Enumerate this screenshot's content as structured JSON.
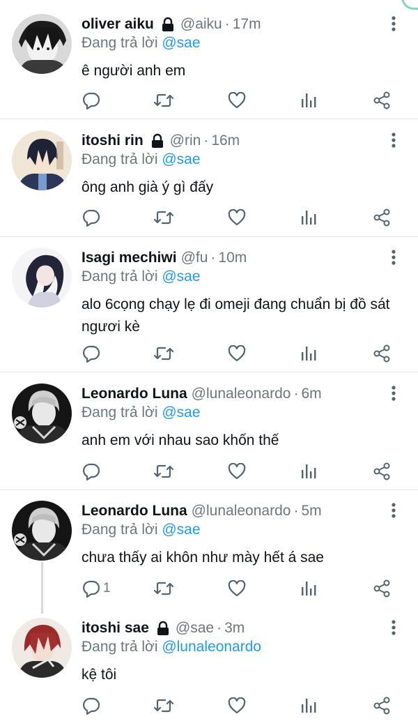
{
  "reply_prefix": "Đang trả lời",
  "tweets": [
    {
      "name": "oliver aiku",
      "locked": true,
      "handle": "@aiku",
      "sep": "·",
      "time": "17m",
      "reply_to": "@sae",
      "text": "ê người anh em",
      "reply_count": ""
    },
    {
      "name": "itoshi rin",
      "locked": true,
      "handle": "@rin",
      "sep": "·",
      "time": "16m",
      "reply_to": "@sae",
      "text": "ông anh già ý gì đấy",
      "reply_count": ""
    },
    {
      "name": "Isagi mechiwi",
      "locked": false,
      "handle": "@fu",
      "sep": "·",
      "time": "10m",
      "reply_to": "@sae",
      "text": "alo 6cọng chạy lẹ đi omeji đang chuẩn bị đồ sát ngươi kè",
      "reply_count": ""
    },
    {
      "name": "Leonardo Luna",
      "locked": false,
      "handle": "@lunaleonardo",
      "sep": "·",
      "time": "6m",
      "reply_to": "@sae",
      "text": "anh em với nhau sao khốn thế",
      "reply_count": ""
    },
    {
      "name": "Leonardo Luna",
      "locked": false,
      "handle": "@lunaleonardo",
      "sep": "·",
      "time": "5m",
      "reply_to": "@sae",
      "text": "chưa thấy ai khôn như mày hết á sae",
      "reply_count": "1"
    },
    {
      "name": "itoshi sae",
      "locked": true,
      "handle": "@sae",
      "sep": "·",
      "time": "3m",
      "reply_to": "@lunaleonardo",
      "text": "kệ tôi",
      "reply_count": ""
    }
  ],
  "colors": {
    "accent": "#1d9bf0",
    "muted": "#6e767d",
    "text": "#0f1419",
    "divider": "#e3e6e8"
  },
  "icons": [
    "lock-icon",
    "more-vertical-icon",
    "reply-icon",
    "retweet-icon",
    "like-icon",
    "analytics-icon",
    "share-icon"
  ]
}
